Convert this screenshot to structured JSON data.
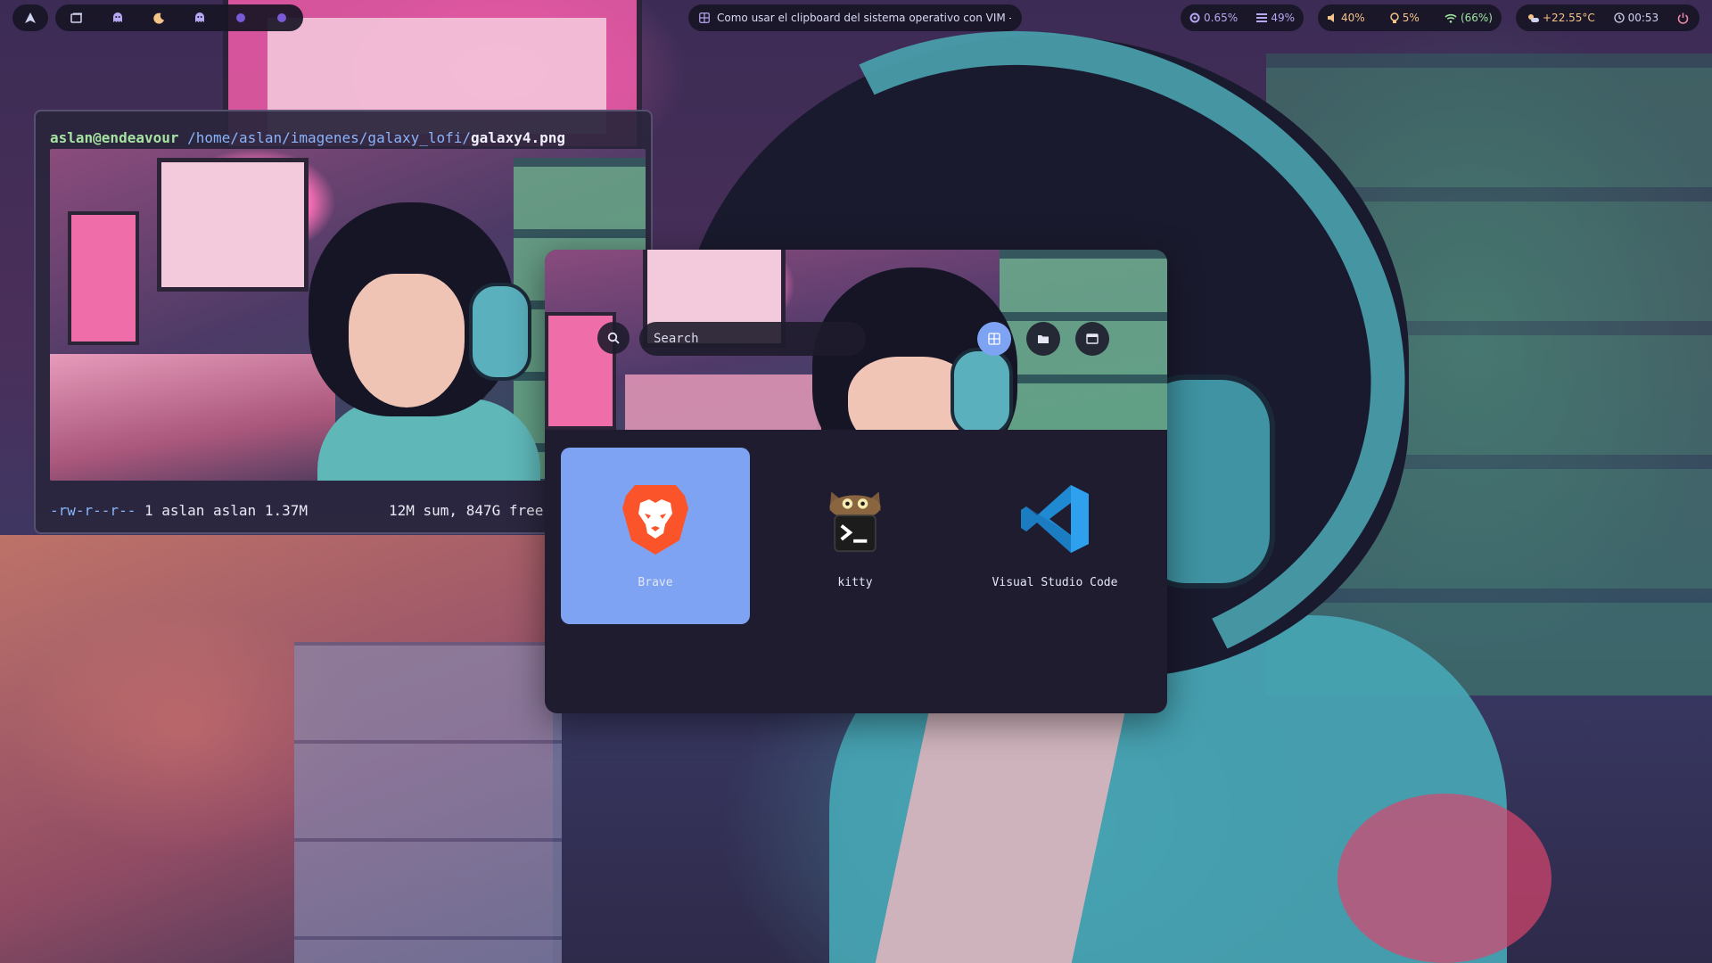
{
  "topbar": {
    "workspaces": [
      {
        "icon": "ghost-icon",
        "color": "#b6a8f2"
      },
      {
        "icon": "moon-icon",
        "color": "#f4c38a"
      },
      {
        "icon": "ghost-icon",
        "color": "#b6a8f2"
      },
      {
        "icon": "dot-icon",
        "color": "#7a5ad6"
      },
      {
        "icon": "dot-icon",
        "color": "#7a5ad6"
      }
    ],
    "window_title": "Como usar el clipboard del sistema operativo con VIM - N...",
    "cpu": "0.65%",
    "memory": "49%",
    "volume": "40%",
    "brightness": "5%",
    "wifi": "(66%)",
    "temperature": "+22.55°C",
    "clock": "00:53"
  },
  "terminal": {
    "user_host": "aslan@endeavour",
    "path": "/home/aslan/imagenes/galaxy_lofi/",
    "filename": "galaxy4.png",
    "permissions": "-rw-r--r--",
    "ls_details": " 1 aslan aslan 1.37M",
    "summary": "12M sum, 847G free"
  },
  "launcher": {
    "search_placeholder": "Search",
    "modes": [
      "apps-grid-icon",
      "folder-icon",
      "window-icon"
    ],
    "active_mode": "apps-grid-icon",
    "apps": [
      {
        "label": "Brave",
        "icon": "brave-lion-icon",
        "selected": true
      },
      {
        "label": "kitty",
        "icon": "kitty-terminal-icon",
        "selected": false
      },
      {
        "label": "Visual Studio Code",
        "icon": "vscode-icon",
        "selected": false
      }
    ]
  },
  "colors": {
    "accent": "#7ea3f2",
    "bar_background": "#18162a",
    "launcher_background": "#1f1c30",
    "terminal_user": "#a6e3a1",
    "terminal_path": "#89b4fa"
  }
}
